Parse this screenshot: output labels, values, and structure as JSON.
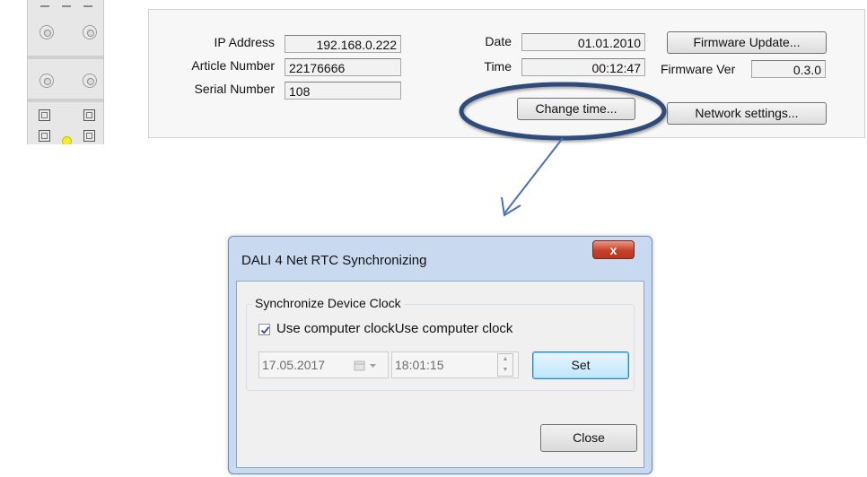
{
  "info_panel": {
    "ip_label": "IP Address",
    "ip_value": "192.168.0.222",
    "article_label": "Article Number",
    "article_value": "22176666",
    "serial_label": "Serial Number",
    "serial_value": "108",
    "date_label": "Date",
    "date_value": "01.01.2010",
    "time_label": "Time",
    "time_value": "00:12:47",
    "firmware_update_button": "Firmware Update...",
    "firmware_ver_label": "Firmware Ver",
    "firmware_ver_value": "0.3.0",
    "change_time_button": "Change time...",
    "network_settings_button": "Network settings..."
  },
  "dialog": {
    "title": "DALI 4 Net RTC Synchronizing",
    "close_glyph": "x",
    "group_title": "Synchronize Device Clock",
    "checkbox_checked": true,
    "checkbox_label": "Use computer clockUse computer clock",
    "date_value": "17.05.2017",
    "time_value": "18:01:15",
    "set_button": "Set",
    "close_button": "Close"
  },
  "colors": {
    "highlight_ellipse": "#2e4c7c",
    "arrow": "#4a72b0",
    "title_bar": "#c9daf0",
    "close_button_red": "#c4402a"
  }
}
